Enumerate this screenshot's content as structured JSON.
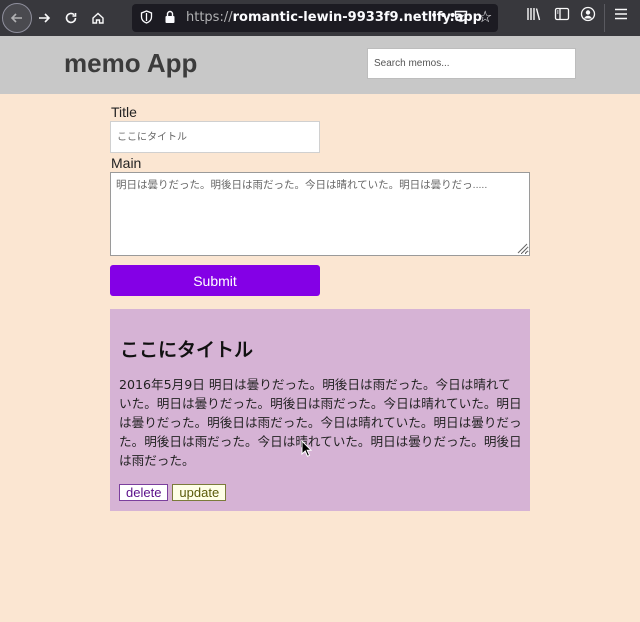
{
  "browser": {
    "url_scheme": "https://",
    "url_host": "romantic-lewin-9933f9.netlify.app",
    "icons": {
      "back": "back-arrow-icon",
      "forward": "forward-arrow-icon",
      "reload": "reload-icon",
      "home": "home-icon",
      "shield": "shield-icon",
      "lock": "lock-icon",
      "more": "more-dots-icon",
      "pocket": "pocket-icon",
      "bookmark": "star-icon",
      "library": "library-icon",
      "sidebar": "sidebar-icon",
      "account": "account-icon",
      "menu": "hamburger-menu-icon"
    }
  },
  "header": {
    "title": "memo App",
    "search_placeholder": "Search memos..."
  },
  "form": {
    "title_label": "Title",
    "title_placeholder": "ここにタイトル",
    "main_label": "Main",
    "main_placeholder": "明日は曇りだった。明後日は雨だった。今日は晴れていた。明日は曇りだっ.....",
    "submit_label": "Submit"
  },
  "memo": {
    "title": "ここにタイトル",
    "body": "2016年5月9日 明日は曇りだった。明後日は雨だった。今日は晴れていた。明日は曇りだった。明後日は雨だった。今日は晴れていた。明日は曇りだった。明後日は雨だった。今日は晴れていた。明日は曇りだった。明後日は雨だった。今日は晴れていた。明日は曇りだった。明後日は雨だった。",
    "delete_label": "delete",
    "update_label": "update"
  },
  "colors": {
    "page_bg": "#fbe6d2",
    "header_bg": "#c8c8c8",
    "submit_bg": "#8400e6",
    "card_bg": "#d6b3d5"
  }
}
